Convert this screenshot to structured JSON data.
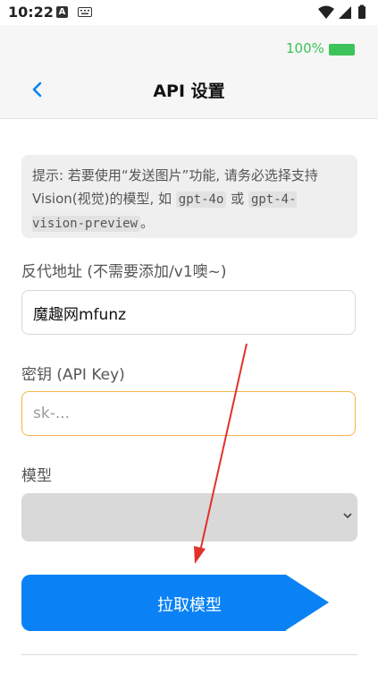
{
  "system_bar": {
    "time": "10:22",
    "notification_icon_letter": "A",
    "icons": [
      "notification-a-icon",
      "keyboard-icon",
      "wifi-icon",
      "signal-icon",
      "battery-icon"
    ]
  },
  "app_status": {
    "time": "上午10:22",
    "battery_percent": "100%",
    "battery_color": "#3cc45b"
  },
  "header": {
    "title": "API 设置",
    "back_icon": "chevron-left-icon"
  },
  "hint": {
    "text_1": "提示: 若要使用“发送图片”功能, 请务必选择支持Vision(视觉)的模型, 如",
    "model_a": "gpt-4o",
    "connector": "或",
    "model_b": "gpt-4-vision-preview",
    "end": "。"
  },
  "proxy": {
    "label": "反代地址 (不需要添加/v1噢~)",
    "value": "魔趣网mfunz"
  },
  "api_key": {
    "label": "密钥 (API Key)",
    "placeholder": "sk-...",
    "value": ""
  },
  "model": {
    "label": "模型",
    "selected": ""
  },
  "fetch_button": {
    "label": "拉取模型"
  },
  "colors": {
    "accent": "#0a82f5",
    "annotation_arrow": "#e0322b",
    "focus_border": "#f5b64a"
  }
}
